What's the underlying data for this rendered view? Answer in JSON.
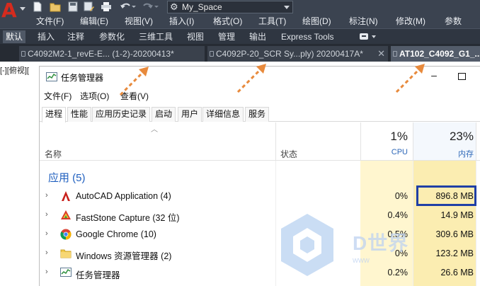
{
  "autocad": {
    "logo_letter": "A",
    "workspace": "My_Space",
    "menu": [
      "文件(F)",
      "编辑(E)",
      "视图(V)",
      "插入(I)",
      "格式(O)",
      "工具(T)",
      "绘图(D)",
      "标注(N)",
      "修改(M)",
      "参数"
    ],
    "ribbon_tabs": [
      "默认",
      "插入",
      "注释",
      "参数化",
      "三维工具",
      "视图",
      "管理",
      "输出",
      "Express Tools"
    ],
    "active_ribbon_tab": "默认",
    "document_tabs": [
      {
        "label": "C4092M2-1_revE-E... (1-2)-20200413*",
        "active": false
      },
      {
        "label": "C4092P-20_SCR Sy...ply) 20200417A*",
        "active": false
      },
      {
        "label": "AT102_C4092_G1_...",
        "active": true
      }
    ],
    "viewport_label": "[-][俯视][",
    "icons": [
      "new-icon",
      "open-icon",
      "save-icon",
      "saveas-icon",
      "print-icon",
      "undo-icon",
      "redo-icon",
      "gear-icon"
    ]
  },
  "task_manager": {
    "title": "任务管理器",
    "menu": [
      "文件(F)",
      "选项(O)",
      "查看(V)"
    ],
    "tabs": [
      "进程",
      "性能",
      "应用历史记录",
      "启动",
      "用户",
      "详细信息",
      "服务"
    ],
    "active_tab": "进程",
    "columns": {
      "name": "名称",
      "status": "状态",
      "cpu_pct": "1%",
      "cpu_label": "CPU",
      "mem_pct": "23%",
      "mem_label": "内存"
    },
    "group_title": "应用 (5)",
    "rows": [
      {
        "name": "AutoCAD Application (4)",
        "cpu": "0%",
        "mem": "896.8 MB",
        "icon": "autocad-icon",
        "highlighted": true
      },
      {
        "name": "FastStone Capture (32 位)",
        "cpu": "0.4%",
        "mem": "14.9 MB",
        "icon": "faststone-icon"
      },
      {
        "name": "Google Chrome (10)",
        "cpu": "0.5%",
        "mem": "309.6 MB",
        "icon": "chrome-icon"
      },
      {
        "name": "Windows 资源管理器 (2)",
        "cpu": "0%",
        "mem": "123.2 MB",
        "icon": "folder-icon"
      },
      {
        "name": "任务管理器",
        "cpu": "0.2%",
        "mem": "26.6 MB",
        "icon": "taskmgr-icon"
      }
    ],
    "highlight_color": "#1f3fa6"
  },
  "watermark": {
    "text": "D世界",
    "sub": "www"
  },
  "annotation_color": "#e88a3c"
}
